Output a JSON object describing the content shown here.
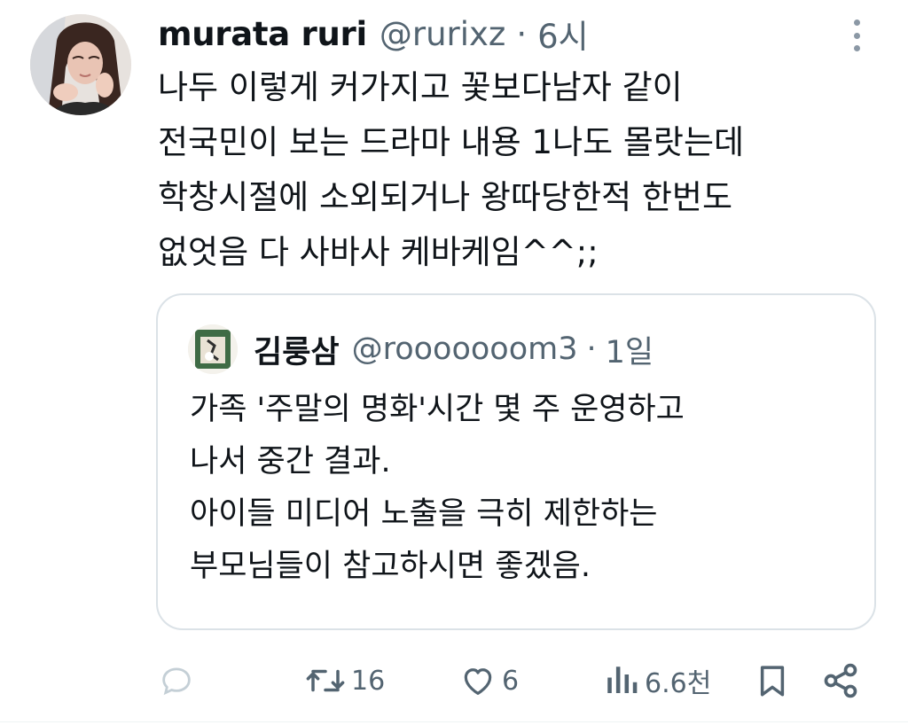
{
  "tweet": {
    "author": {
      "name": "murata ruri",
      "handle": "@rurixz",
      "separator": "·",
      "time": "6시"
    },
    "text_lines": [
      "나두 이렇게 커가지고 꽃보다남자 같이",
      "전국민이 보는 드라마 내용 1나도 몰랏는데",
      "학창시절에 소외되거나 왕따당한적 한번도",
      "없엇음 다 사바사 케바케임^^;;"
    ],
    "quote": {
      "author": {
        "name": "김룽삼",
        "handle": "@rooooooom3",
        "separator": "·",
        "time": "1일"
      },
      "text_lines": [
        "가족 '주말의 명화'시간 몇 주 운영하고",
        "나서 중간 결과.",
        "아이들 미디어 노출을 극히 제한하는",
        "부모님들이 참고하시면 좋겠음."
      ]
    },
    "actions": {
      "reply": {
        "icon": "reply-icon",
        "count": ""
      },
      "retweet": {
        "icon": "retweet-icon",
        "count": "16"
      },
      "like": {
        "icon": "heart-icon",
        "count": "6"
      },
      "views": {
        "icon": "views-bar-chart-icon",
        "count": "6.6천"
      },
      "bookmark": {
        "icon": "bookmark-icon"
      },
      "share": {
        "icon": "share-icon"
      }
    }
  },
  "colors": {
    "text_primary": "#0f1419",
    "text_secondary": "#536471",
    "border": "#dbe2e7"
  }
}
